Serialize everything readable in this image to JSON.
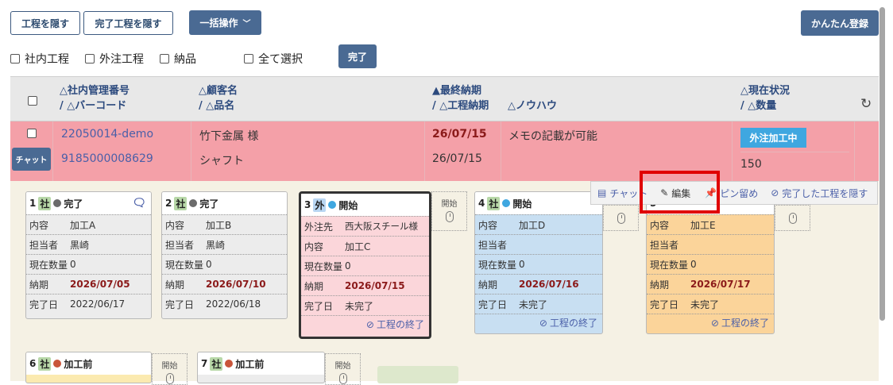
{
  "toolbar": {
    "hide_process": "工程を隠す",
    "hide_done_process": "完了工程を隠す",
    "bulk_ops": "一括操作",
    "quick_register": "かんたん登録",
    "complete": "完了"
  },
  "filters": {
    "in_house": "社内工程",
    "outsourced": "外注工程",
    "delivery": "納品",
    "select_all": "全て選択"
  },
  "table_header": {
    "col1_line1": "△社内管理番号",
    "col1_line2": "/ △バーコード",
    "col2_line1": "△顧客名",
    "col2_line2": "/ △品名",
    "col3_line1": "▲最終納期",
    "col3_line2": "/ △工程納期",
    "col4": "△ノウハウ",
    "col5_line1": "△現在状況",
    "col5_line2": "/ △数量"
  },
  "row": {
    "chat_btn": "チャット",
    "mgmt_no": "22050014-demo",
    "barcode": "9185000008629",
    "customer": "竹下金属 様",
    "product": "シャフト",
    "final_due": "26/07/15",
    "process_due": "26/07/15",
    "knowhow": "メモの記載が可能",
    "status": "外注加工中",
    "qty": "150"
  },
  "context_menu": {
    "chat": "チャット",
    "edit": "編集",
    "pin": "ピン留め",
    "hide_done": "完了した工程を隠す"
  },
  "labels": {
    "content": "内容",
    "person": "担当者",
    "qty": "現在数量",
    "due": "納期",
    "done_date": "完了日",
    "vendor": "外注先",
    "finish": "工程の終了",
    "start": "開始",
    "tag_in": "社",
    "tag_out": "外"
  },
  "cards": [
    {
      "no": "1",
      "status": "完了",
      "content": "加工A",
      "person": "黒崎",
      "qty": "0",
      "due": "2026/07/05",
      "done": "2022/06/17",
      "dot": "#6b6b6b"
    },
    {
      "no": "2",
      "status": "完了",
      "content": "加工B",
      "person": "黒崎",
      "qty": "0",
      "due": "2026/07/10",
      "done": "2022/06/18",
      "dot": "#6b6b6b"
    },
    {
      "no": "3",
      "status": "開始",
      "vendor": "西大阪スチール様",
      "content": "加工C",
      "qty": "0",
      "due": "2026/07/15",
      "done": "未完了",
      "dot": "#3fa7e0"
    },
    {
      "no": "4",
      "status": "開始",
      "content": "加工D",
      "person": "",
      "qty": "0",
      "due": "2026/07/16",
      "done": "未完了",
      "dot": "#3fa7e0"
    },
    {
      "no": "5",
      "status": "",
      "content": "加工E",
      "person": "",
      "qty": "0",
      "due": "2026/07/17",
      "done": "未完了",
      "dot": "#3fa7e0"
    },
    {
      "no": "6",
      "status": "加工前",
      "dot": "#c9553a"
    },
    {
      "no": "7",
      "status": "加工前",
      "dot": "#c9553a"
    }
  ],
  "colors": {
    "accent": "#4a6a93",
    "row_highlight": "#f4a0a8",
    "status_badge": "#3fa7e0",
    "card_outsourced": "#fbd6da",
    "card_started": "#c8dff2",
    "card_orange": "#fbd49a",
    "highlight_box": "#e00000"
  }
}
